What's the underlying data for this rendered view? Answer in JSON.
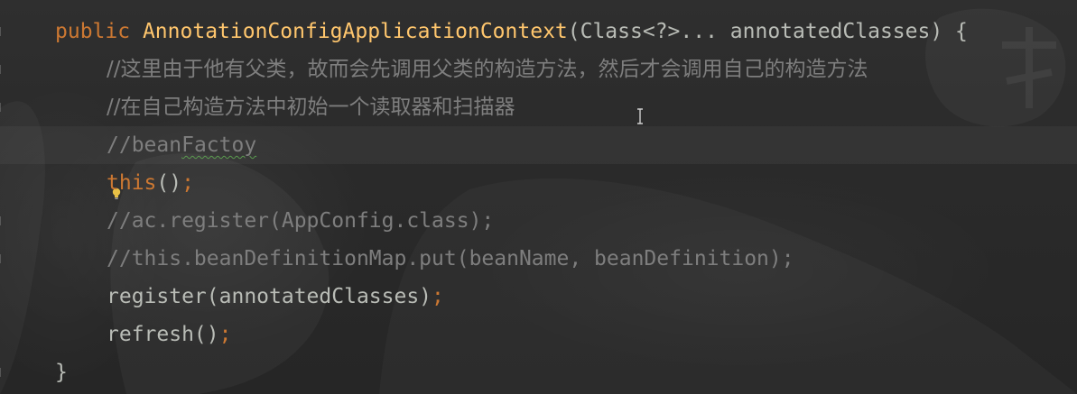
{
  "editor": {
    "lines": {
      "l1": {
        "kw_public": "public",
        "fn_name": "AnnotationConfigApplicationContext",
        "params": "(Class<?>... annotatedClasses) {"
      },
      "l2": {
        "comment": "//这里由于他有父类，故而会先调用父类的构造方法，然后才会调用自己的构造方法"
      },
      "l3": {
        "comment": "//在自己构造方法中初始一个读取器和扫描器"
      },
      "l4": {
        "comment_prefix": "//bean",
        "comment_typo": "Factoy"
      },
      "l5": {
        "kw_this": "this",
        "paren": "()",
        "semicolon": ";"
      },
      "l6": {
        "comment": "//ac.register(AppConfig.class);"
      },
      "l7": {
        "comment": "//this.beanDefinitionMap.put(beanName, beanDefinition);"
      },
      "l8": {
        "call": "register(annotatedClasses)",
        "semicolon": ";"
      },
      "l9": {
        "call": "refresh()",
        "semicolon": ";"
      },
      "l10": {
        "brace": "}"
      }
    },
    "colors": {
      "keyword": "#cc7832",
      "function": "#ffc66d",
      "comment": "#7e7e7e",
      "text": "#b9bcb6",
      "background": "#2b2b2b"
    },
    "icons": {
      "intention": "lightbulb-icon",
      "cursor": "text-cursor-icon"
    }
  }
}
